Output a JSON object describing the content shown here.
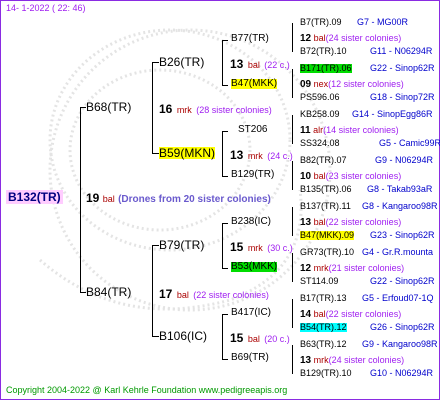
{
  "header": {
    "date": "14-  1-2022  (  22:  46)"
  },
  "footer": {
    "copyright": "Copyright 2004-2022 @ Karl Kehrle Foundation    www.pedigreeapis.org"
  },
  "root": {
    "name": "B132(TR)",
    "count": "19",
    "bal": "bal",
    "desc": "(Drones from 20 sister colonies)"
  },
  "gen1": [
    {
      "name": "B68(TR)",
      "count": "16",
      "bal": "mrk",
      "desc": "(28 sister colonies)"
    },
    {
      "name": "B84(TR)",
      "count": "17",
      "bal": "bal",
      "desc": "(22 sister colonies)"
    }
  ],
  "gen2": [
    {
      "name": "B26(TR)",
      "count": "13",
      "bal": "bal",
      "desc": "(22 c.)"
    },
    {
      "name": "B59(MKN)",
      "count": "13",
      "bal": "mrk",
      "desc": "(24 c.)"
    },
    {
      "name": "B79(TR)",
      "count": "15",
      "bal": "mrk",
      "desc": "(30 c.)"
    },
    {
      "name": "B106(IC)",
      "count": "15",
      "bal": "bal",
      "desc": "(20 c.)"
    }
  ],
  "gen3": [
    {
      "name": "B77(TR)",
      "count": "12",
      "bal": "bal",
      "desc": "(24 sister colonies)"
    },
    {
      "name": "B47(MKK)",
      "count": "09",
      "bal": "nex",
      "desc": "(12 sister colonies)"
    },
    {
      "name": "ST206",
      "count": "11",
      "bal": "alr",
      "desc": "(14 sister colonies)"
    },
    {
      "name": "B129(TR)",
      "count": "10",
      "bal": "bal",
      "desc": "(23 sister colonies)"
    },
    {
      "name": "B238(IC)",
      "count": "13",
      "bal": "bal",
      "desc": "(22 sister colonies)"
    },
    {
      "name": "B53(MKK)",
      "count": "12",
      "bal": "mrk",
      "desc": "(21 sister colonies)"
    },
    {
      "name": "B417(IC)",
      "count": "14",
      "bal": "bal",
      "desc": "(22 sister colonies)"
    },
    {
      "name": "B69(TR)",
      "count": "13",
      "bal": "mrk",
      "desc": "(24 sister colonies)"
    }
  ],
  "gen4": [
    {
      "name": "B7(TR).09",
      "code": "G7 - MG00R"
    },
    {
      "name": "B72(TR).10",
      "code": "G11 - N06294R"
    },
    {
      "name": "B171(TR).06",
      "code": "G22 - Sinop62R"
    },
    {
      "name": "PS596.06",
      "code": "G18 - Sinop72R"
    },
    {
      "name": "KB258.09",
      "code": "G14 - SinopEgg86R"
    },
    {
      "name": "SS324.08",
      "code": "G5 - Camic99R"
    },
    {
      "name": "B82(TR).07",
      "code": "G9 - N06294R"
    },
    {
      "name": "B135(TR).06",
      "code": "G8 - Takab93aR"
    },
    {
      "name": "B137(TR).11",
      "code": "G8 - Kangaroo98R"
    },
    {
      "name": "B47(MKK).09",
      "code": "G23 - Sinop62R"
    },
    {
      "name": "GR73(TR).10",
      "code": "G4 - Gr.R.mounta"
    },
    {
      "name": "ST114.09",
      "code": "G22 - Sinop62R"
    },
    {
      "name": "B17(TR).13",
      "code": "G5 - Erfoud07-1Q"
    },
    {
      "name": "B54(TR).12",
      "code": "G26 - Sinop62R"
    },
    {
      "name": "B63(TR).12",
      "code": "G9 - Kangaroo98R"
    },
    {
      "name": "B129(TR).10",
      "code": "G10 - N06294R"
    }
  ]
}
